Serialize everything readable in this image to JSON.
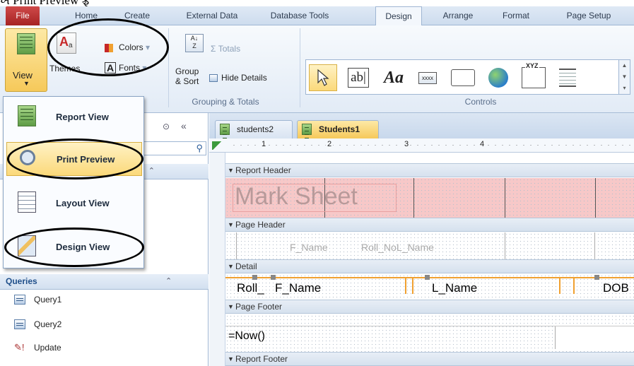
{
  "top_caption": "ખ Print Preview ફ્રે",
  "ribbon_tabs": [
    "File",
    "Home",
    "Create",
    "External Data",
    "Database Tools",
    "Design",
    "Arrange",
    "Format",
    "Page Setup"
  ],
  "views": {
    "view_label": "View",
    "themes_label": "Themes",
    "colors_label": "Colors",
    "fonts_label": "Fonts"
  },
  "grouping": {
    "totals_label": "Σ Totals",
    "group_label_line1": "Group",
    "group_label_line2": "& Sort",
    "hide_details_label": "Hide Details",
    "group_caption": "Grouping & Totals"
  },
  "controls": {
    "caption": "Controls",
    "text_box": "ab|",
    "label": "Aa",
    "xxxx": "xxxx",
    "xyz": "XYZ"
  },
  "view_menu": [
    {
      "label": "Report View",
      "selected": false
    },
    {
      "label": "Print Preview",
      "selected": true
    },
    {
      "label": "Layout View",
      "selected": false
    },
    {
      "label": "Design View",
      "selected": false
    }
  ],
  "nav": {
    "queries_label": "Queries",
    "items": [
      "Query1",
      "Query2",
      "Update"
    ]
  },
  "doc_tabs": [
    "students2",
    "Students1"
  ],
  "ruler_numbers": [
    "1",
    "2",
    "3",
    "4"
  ],
  "report": {
    "report_header": "Report Header",
    "title": "Mark Sheet",
    "page_header": "Page Header",
    "header_fields": [
      "F_Name",
      "Roll_No",
      "L_Name"
    ],
    "detail": "Detail",
    "detail_fields": [
      "Roll_",
      "F_Name",
      "L_Name",
      "DOB"
    ],
    "page_footer": "Page Footer",
    "footer_expr": "=Now()",
    "report_footer": "Report Footer"
  },
  "colors": {
    "file_tab": "#b83232",
    "accent_orange": "#f0a030",
    "report_header_fill": "#f7c8c8",
    "selected_menu": "#fbd97b"
  }
}
